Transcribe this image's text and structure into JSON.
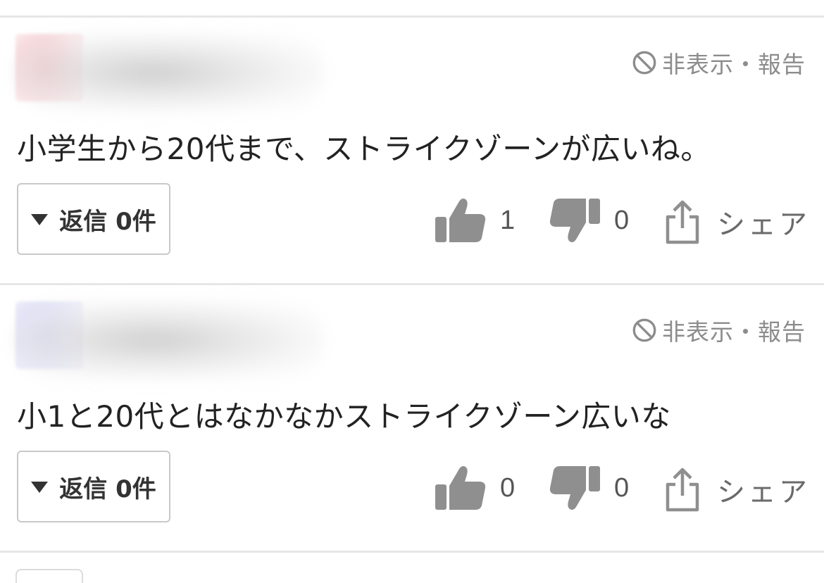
{
  "comments": [
    {
      "text": "小学生から20代まで、ストライクゾーンが広いね。",
      "hide_report": "非表示・報告",
      "reply_label": "返信 0件",
      "likes": "1",
      "dislikes": "0",
      "share_label": "シェア"
    },
    {
      "text": "小1と20代とはなかなかストライクゾーン広いな",
      "hide_report": "非表示・報告",
      "reply_label": "返信 0件",
      "likes": "0",
      "dislikes": "0",
      "share_label": "シェア"
    }
  ],
  "icons": {
    "hide": "prohibited-icon",
    "reply_toggle": "triangle-down-icon",
    "like": "thumbs-up-icon",
    "dislike": "thumbs-down-icon",
    "share": "share-icon"
  },
  "colors": {
    "icon_gray": "#8f8f8f",
    "divider": "#e6e6e6",
    "muted_text": "#8c8c8c"
  }
}
